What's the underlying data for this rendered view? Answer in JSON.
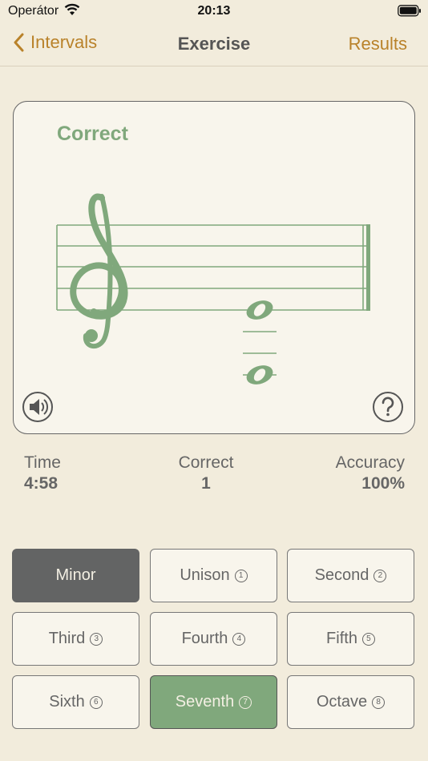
{
  "status": {
    "carrier": "Operátor",
    "time": "20:13"
  },
  "nav": {
    "back_label": "Intervals",
    "title": "Exercise",
    "right_label": "Results"
  },
  "card": {
    "feedback": "Correct"
  },
  "stats": {
    "time_label": "Time",
    "time_value": "4:58",
    "correct_label": "Correct",
    "correct_value": "1",
    "accuracy_label": "Accuracy",
    "accuracy_value": "100%"
  },
  "buttons": [
    {
      "label": "Minor",
      "num": ""
    },
    {
      "label": "Unison",
      "num": "1"
    },
    {
      "label": "Second",
      "num": "2"
    },
    {
      "label": "Third",
      "num": "3"
    },
    {
      "label": "Fourth",
      "num": "4"
    },
    {
      "label": "Fifth",
      "num": "5"
    },
    {
      "label": "Sixth",
      "num": "6"
    },
    {
      "label": "Seventh",
      "num": "7"
    },
    {
      "label": "Octave",
      "num": "8"
    }
  ],
  "colors": {
    "accent": "#b9822a",
    "green": "#80a87c",
    "dark": "#636464",
    "background": "#f2ecdc"
  }
}
